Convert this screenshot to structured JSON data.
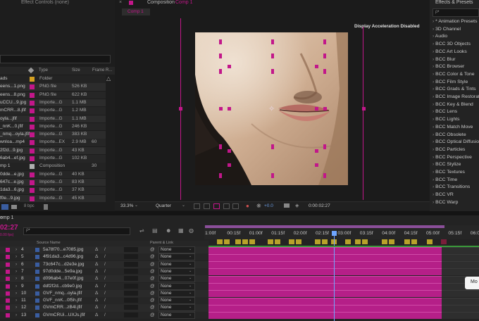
{
  "effect_controls_tab": "Effect Controls (none)",
  "composition_tab": {
    "label": "Composition",
    "name": "Comp 1"
  },
  "comp_subtab": "Comp 1",
  "display_notice": "Display Acceleration Disabled",
  "effects_panel": {
    "title": "Effects & Presets",
    "search_placeholder": "ρ•",
    "items": [
      "* Animation Presets",
      "3D Channel",
      "Audio",
      "BCC 3D Objects",
      "BCC Art Looks",
      "BCC Blur",
      "BCC Browser",
      "BCC Color & Tone",
      "BCC Film Style",
      "BCC Grads & Tints",
      "BCC Image Restorat",
      "BCC Key & Blend",
      "BCC Lens",
      "BCC Lights",
      "BCC Match Move",
      "BCC Obsolete",
      "BCC Optical Diffusio",
      "BCC Particles",
      "BCC Perspective",
      "BCC Stylize",
      "BCC Textures",
      "BCC Time",
      "BCC Transitions",
      "BCC VR",
      "BCC Warp"
    ]
  },
  "project": {
    "headers": {
      "type": "Type",
      "size": "Size",
      "frame": "Frame R..."
    },
    "rows": [
      {
        "name": "ads",
        "type": "Folder",
        "size": "",
        "frame": ""
      },
      {
        "name": "eens...1.png",
        "type": "PNG file",
        "size": "526 KB",
        "frame": ""
      },
      {
        "name": "eens...8.png",
        "type": "PNG file",
        "size": "622 KB",
        "frame": ""
      },
      {
        "name": "uCCU...9.jpg",
        "type": "Importe...G",
        "size": "1.1 MB",
        "frame": ""
      },
      {
        "name": "mCRR...8.jfif",
        "type": "Importe...G",
        "size": "1.2 MB",
        "frame": ""
      },
      {
        "name": "oyla...jfif",
        "type": "Importe...G",
        "size": "1.1 MB",
        "frame": ""
      },
      {
        "name": "_nnK...0.jfif",
        "type": "Importe...G",
        "size": "246 KB",
        "frame": ""
      },
      {
        "name": "_nmq...oyla.jfif",
        "type": "Importe...G",
        "size": "383 KB",
        "frame": ""
      },
      {
        "name": "wnloa...mp4",
        "type": "Importe...EX",
        "size": "2.9 MB",
        "frame": "60"
      },
      {
        "name": "2f2d...9.jpg",
        "type": "Importe...G",
        "size": "43 KB",
        "frame": ""
      },
      {
        "name": "6ab4...ef.jpg",
        "type": "Importe...G",
        "size": "102 KB",
        "frame": ""
      },
      {
        "name": "mp 1",
        "type": "Composition",
        "size": "",
        "frame": "30"
      },
      {
        "name": "0dde...e.jpg",
        "type": "Importe...G",
        "size": "40 KB",
        "frame": ""
      },
      {
        "name": "647c...e.jpg",
        "type": "Importe...G",
        "size": "83 KB",
        "frame": ""
      },
      {
        "name": "1da3...6.jpg",
        "type": "Importe...G",
        "size": "37 KB",
        "frame": ""
      },
      {
        "name": "f0e...9.jpg",
        "type": "Importe...G",
        "size": "45 KB",
        "frame": ""
      }
    ],
    "bpc": "8 bpc"
  },
  "viewer_bar": {
    "zoom": "33.3%",
    "resolution": "Quarter",
    "exposure": "+0.0",
    "timecode": "0:00:02:27"
  },
  "timeline": {
    "tab": "omp 1",
    "timecode": "02:27",
    "fps": "0.00 fps)",
    "col_source": "Source Name",
    "col_parent": "Parent & Link",
    "ruler": [
      "1:00f",
      "00:15f",
      "01:00f",
      "01:15f",
      "02:00f",
      "02:15f",
      "03:00f",
      "03:15f",
      "04:00f",
      "04:15f",
      "05:00f",
      "05:15f",
      "06:00f"
    ],
    "layers": [
      {
        "num": "4",
        "name": "5a78f70...e7085.jpg",
        "parent": "None"
      },
      {
        "num": "5",
        "name": "4f91da3...c4d96.jpg",
        "parent": "None"
      },
      {
        "num": "6",
        "name": "73c647c...d2e3e.jpg",
        "parent": "None"
      },
      {
        "num": "7",
        "name": "97d0dde...5e9a.jpg",
        "parent": "None"
      },
      {
        "num": "8",
        "name": "d096ab4...07e0f.jpg",
        "parent": "None"
      },
      {
        "num": "9",
        "name": "ddf2f2d...cb9e0.jpg",
        "parent": "None"
      },
      {
        "num": "10",
        "name": "GVF_nmq...oyla.jfif",
        "parent": "None"
      },
      {
        "num": "11",
        "name": "GVF_nnK...0f5h.jfif",
        "parent": "None"
      },
      {
        "num": "12",
        "name": "GVmCRR...zB4l.jfif",
        "parent": "None"
      },
      {
        "num": "13",
        "name": "GVmCRUi...UXJs.jfif",
        "parent": "None"
      }
    ]
  },
  "tooltip": "Mo",
  "colors": {
    "accent": "#c2178a",
    "bg": "#1b1b1b",
    "panel": "#232323",
    "keyframe": "#b8a22a"
  }
}
